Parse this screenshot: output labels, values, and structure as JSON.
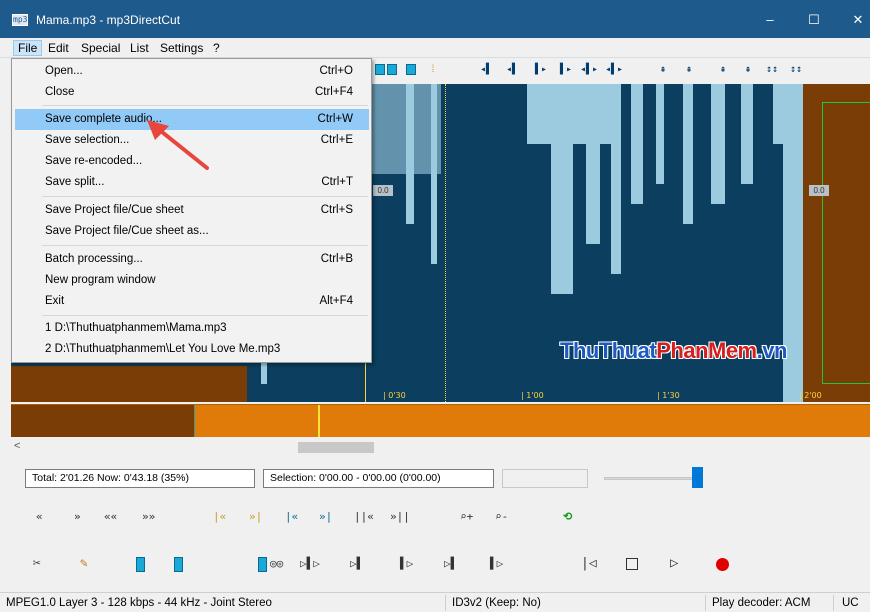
{
  "window": {
    "title": "Mama.mp3 - mp3DirectCut",
    "app_icon": "mp3"
  },
  "window_buttons": {
    "minimize": "–",
    "maximize": "☐",
    "close": "✕"
  },
  "menubar": {
    "items": [
      "File",
      "Edit",
      "Special",
      "List",
      "Settings",
      "?"
    ]
  },
  "file_menu": {
    "items": [
      {
        "label": "Open...",
        "shortcut": "Ctrl+O"
      },
      {
        "label": "Close",
        "shortcut": "Ctrl+F4"
      },
      {
        "label": "Save complete audio...",
        "shortcut": "Ctrl+W",
        "highlighted": true
      },
      {
        "label": "Save selection...",
        "shortcut": "Ctrl+E"
      },
      {
        "label": "Save re-encoded...",
        "shortcut": ""
      },
      {
        "label": "Save split...",
        "shortcut": "Ctrl+T"
      },
      {
        "label": "Save Project file/Cue sheet",
        "shortcut": "Ctrl+S"
      },
      {
        "label": "Save Project file/Cue sheet as...",
        "shortcut": ""
      },
      {
        "label": "Batch processing...",
        "shortcut": "Ctrl+B"
      },
      {
        "label": "New program window",
        "shortcut": ""
      },
      {
        "label": "Exit",
        "shortcut": "Alt+F4"
      },
      {
        "label": "1 D:\\Thuthuatphanmem\\Mama.mp3",
        "shortcut": ""
      },
      {
        "label": "2 D:\\Thuthuatphanmem\\Let You Love Me.mp3",
        "shortcut": ""
      }
    ]
  },
  "waveform": {
    "time_marks": [
      "0'30",
      "1'00",
      "1'30",
      "2'00"
    ],
    "level_labels": [
      "0.0",
      "0.0"
    ],
    "colors": {
      "background": "#0b3e5f",
      "peaks": "#9ccbe0",
      "cut_region": "#7b3d06",
      "selection_border": "#27c43a",
      "time_marks": "#ffd13b"
    }
  },
  "watermark": {
    "part1": "ThuThuat",
    "part2": "PhanMem",
    "part3": ".vn"
  },
  "status_fields": {
    "total": "Total: 2'01.26  Now: 0'43.18  (35%)",
    "selection": "Selection: 0'00.00 - 0'00.00 (0'00.00)",
    "empty": ""
  },
  "statusbar": {
    "format": "MPEG1.0 Layer 3 - 128 kbps - 44 kHz - Joint Stereo",
    "tag": "ID3v2 (Keep: No)",
    "decoder": "Play decoder: ACM",
    "mode": "UC"
  },
  "scroll": {
    "left_arrow": "<"
  },
  "transport": {
    "row1": [
      "«",
      "»",
      "«« ",
      "»»",
      "|«",
      "»|",
      "|«",
      "»|",
      "||«",
      "»||",
      "⌕+",
      "⌕-",
      "⟲"
    ],
    "row2": [
      "scissors-icon",
      "pencil-icon",
      "block",
      "block",
      "block-loop",
      "play-selection",
      "play-to-cursor",
      "play-from-cursor",
      "play-block",
      "play-end",
      "skip-start",
      "stop",
      "play",
      "record"
    ]
  }
}
